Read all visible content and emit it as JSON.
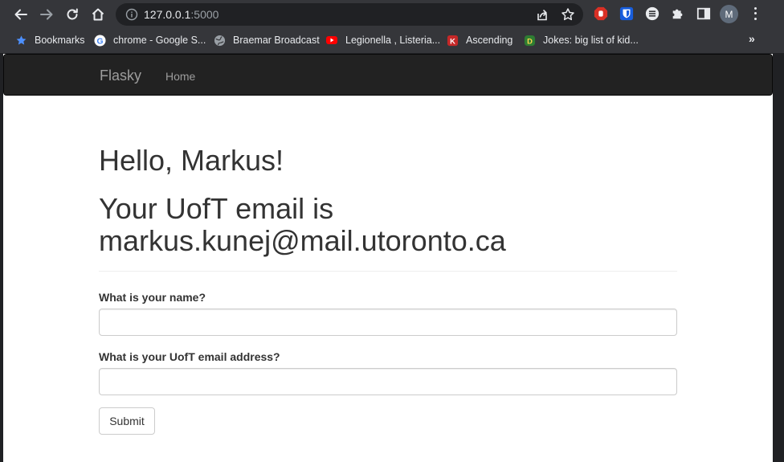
{
  "browser": {
    "url_host": "127.0.0.1",
    "url_port": ":5000",
    "profile_initial": "M",
    "bookmarks": [
      {
        "label": "Bookmarks",
        "icon": "star-icon"
      },
      {
        "label": "chrome - Google S...",
        "icon": "google-icon"
      },
      {
        "label": "Braemar Broadcast",
        "icon": "globe-icon"
      },
      {
        "label": "Legionella , Listeria...",
        "icon": "youtube-icon"
      },
      {
        "label": "Ascending",
        "icon": "k-icon"
      },
      {
        "label": "Jokes: big list of kid...",
        "icon": "d-icon"
      }
    ],
    "more_bookmarks": "»"
  },
  "navbar": {
    "brand": "Flasky",
    "home": "Home"
  },
  "main": {
    "greeting": "Hello, Markus!",
    "email_line1": "Your UofT email is",
    "email_line2": "markus.kunej@mail.utoronto.ca"
  },
  "form": {
    "name_label": "What is your name?",
    "name_value": "",
    "email_label": "What is your UofT email address?",
    "email_value": "",
    "submit_label": "Submit"
  },
  "colors": {
    "navbar_bg": "#222222",
    "navbar_text": "#9d9d9d",
    "heading_text": "#333333",
    "chrome_toolbar": "#35363a",
    "chrome_omnibox": "#202124"
  }
}
